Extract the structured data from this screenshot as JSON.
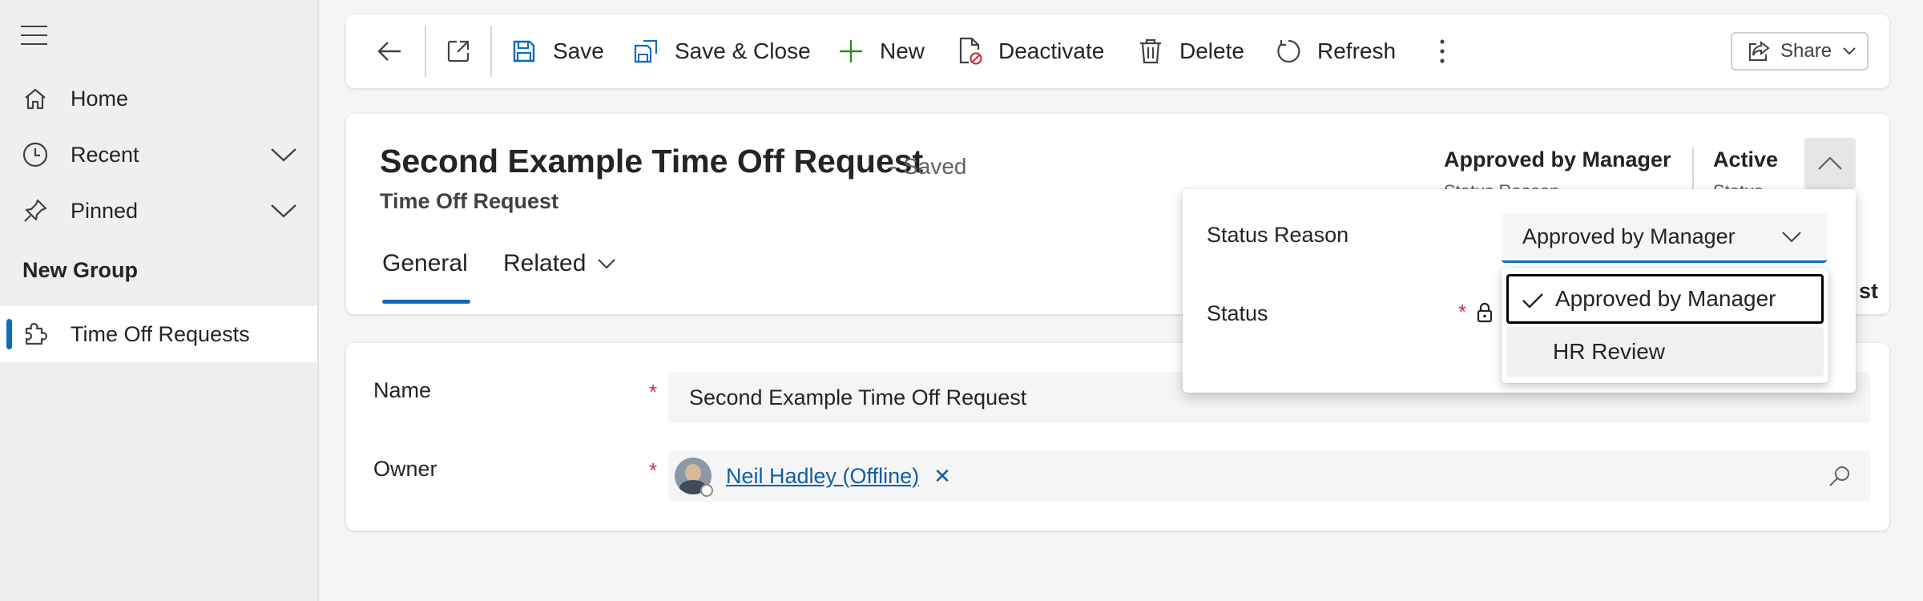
{
  "sidebar": {
    "items": [
      {
        "label": "Home",
        "icon": "home-icon"
      },
      {
        "label": "Recent",
        "icon": "clock-icon"
      },
      {
        "label": "Pinned",
        "icon": "pin-icon"
      }
    ],
    "group_title": "New Group",
    "group_items": [
      {
        "label": "Time Off Requests",
        "icon": "puzzle-icon",
        "selected": true
      }
    ]
  },
  "toolbar": {
    "save": "Save",
    "save_close": "Save & Close",
    "new": "New",
    "deactivate": "Deactivate",
    "delete": "Delete",
    "refresh": "Refresh",
    "share": "Share"
  },
  "record": {
    "title": "Second Example Time Off Request",
    "saved_status": "- Saved",
    "entity": "Time Off Request",
    "tabs": [
      "General",
      "Related"
    ],
    "header_fields": [
      {
        "value": "Approved by Manager",
        "label": "Status Reason"
      },
      {
        "value": "Active",
        "label": "Status"
      }
    ],
    "clipped_text": "st"
  },
  "form": {
    "name_label": "Name",
    "name_value": "Second Example Time Off Request",
    "owner_label": "Owner",
    "owner_value": "Neil Hadley (Offline)",
    "required_marker": "*"
  },
  "flyout": {
    "status_reason_label": "Status Reason",
    "status_label": "Status",
    "status_reason_value": "Approved by Manager",
    "options": [
      "Approved by Manager",
      "HR Review"
    ],
    "selected_option": "Approved by Manager"
  },
  "colors": {
    "accent": "#0f6cbd",
    "required": "#c4314b",
    "link": "#115ea3"
  }
}
